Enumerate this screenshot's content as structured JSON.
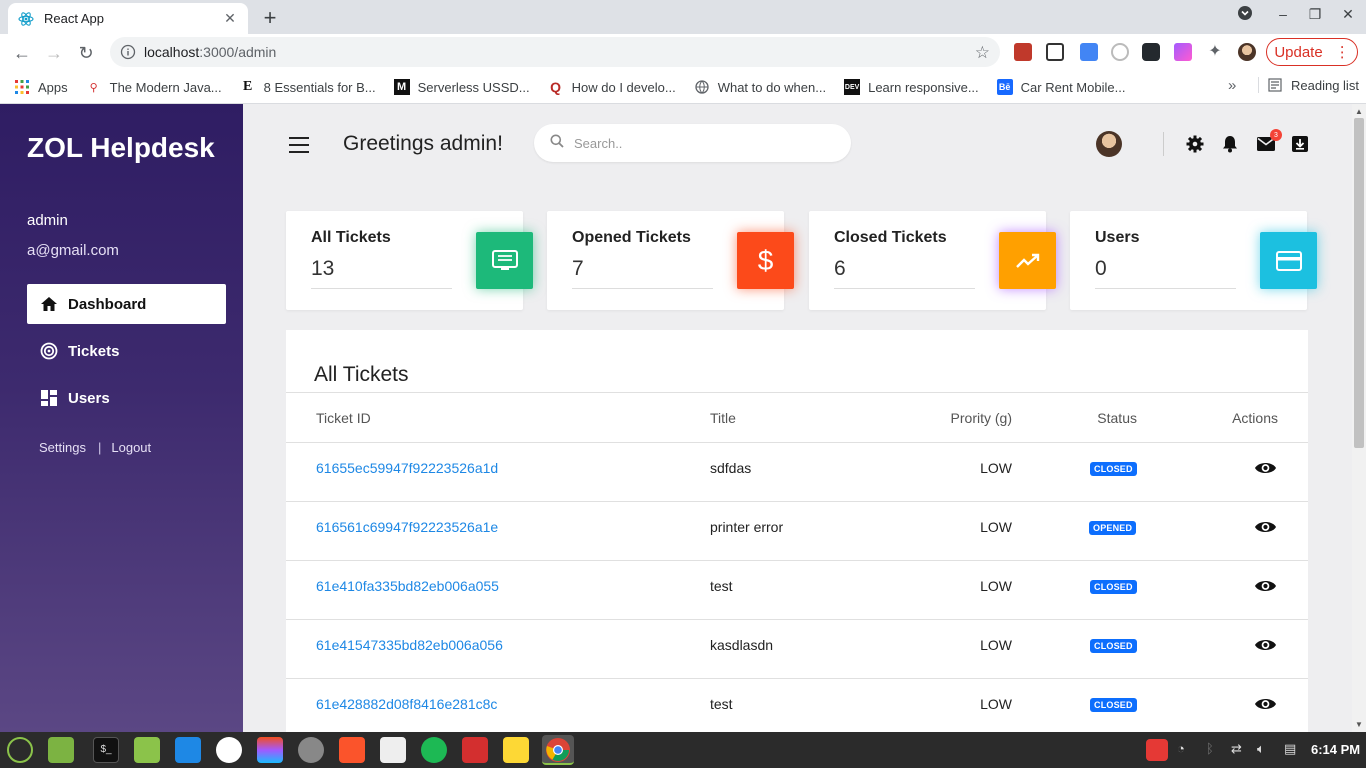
{
  "browser": {
    "tab_title": "React App",
    "url_host": "localhost",
    "url_path": ":3000/admin",
    "update_label": "Update",
    "bookmarks": [
      {
        "label": "Apps",
        "icon": "apps-grid-icon"
      },
      {
        "label": "The Modern Java...",
        "icon": "tower-icon"
      },
      {
        "label": "8 Essentials for B...",
        "icon": "e-logo-icon"
      },
      {
        "label": "Serverless USSD...",
        "icon": "medium-logo-icon"
      },
      {
        "label": "How do I develo...",
        "icon": "quora-logo-icon"
      },
      {
        "label": "What to do when...",
        "icon": "globe-icon"
      },
      {
        "label": "Learn responsive...",
        "icon": "dev-logo-icon"
      },
      {
        "label": "Car Rent Mobile...",
        "icon": "behance-logo-icon"
      }
    ],
    "reading_list": "Reading list"
  },
  "sidebar": {
    "brand": "ZOL Helpdesk",
    "user_name": "admin",
    "user_email": "a@gmail.com",
    "nav": [
      {
        "label": "Dashboard",
        "icon": "home-icon",
        "active": true
      },
      {
        "label": "Tickets",
        "icon": "tickets-icon",
        "active": false
      },
      {
        "label": "Users",
        "icon": "users-grid-icon",
        "active": false
      }
    ],
    "settings_label": "Settings",
    "logout_label": "Logout"
  },
  "header": {
    "greeting": "Greetings admin!",
    "search_placeholder": "Search..",
    "mail_badge": "3"
  },
  "cards": [
    {
      "title": "All Tickets",
      "value": "13",
      "icon": "monitor-icon",
      "color": "#1db97a"
    },
    {
      "title": "Opened Tickets",
      "value": "7",
      "icon": "dollar-icon",
      "color": "#fc4a1a"
    },
    {
      "title": "Closed Tickets",
      "value": "6",
      "icon": "trending-up-icon",
      "color": "#ffa000"
    },
    {
      "title": "Users",
      "value": "0",
      "icon": "credit-card-icon",
      "color": "#1cc0e0"
    }
  ],
  "table": {
    "title": "All Tickets",
    "columns": [
      "Ticket ID",
      "Title",
      "Prority (g)",
      "Status",
      "Actions"
    ],
    "rows": [
      {
        "id": "61655ec59947f92223526a1d",
        "title": "sdfdas",
        "priority": "LOW",
        "status": "CLOSED"
      },
      {
        "id": "616561c69947f92223526a1e",
        "title": "printer error",
        "priority": "LOW",
        "status": "OPENED"
      },
      {
        "id": "61e410fa335bd82eb006a055",
        "title": "test",
        "priority": "LOW",
        "status": "CLOSED"
      },
      {
        "id": "61e41547335bd82eb006a056",
        "title": "kasdlasdn",
        "priority": "LOW",
        "status": "CLOSED"
      },
      {
        "id": "61e428882d08f8416e281c8c",
        "title": "test",
        "priority": "LOW",
        "status": "CLOSED"
      }
    ]
  },
  "taskbar": {
    "clock": "6:14 PM"
  },
  "colors": {
    "sidebar_top": "#2f1d63",
    "sidebar_bottom": "#5b4784",
    "link": "#1e88e5",
    "status_badge": "#0d6efd"
  }
}
